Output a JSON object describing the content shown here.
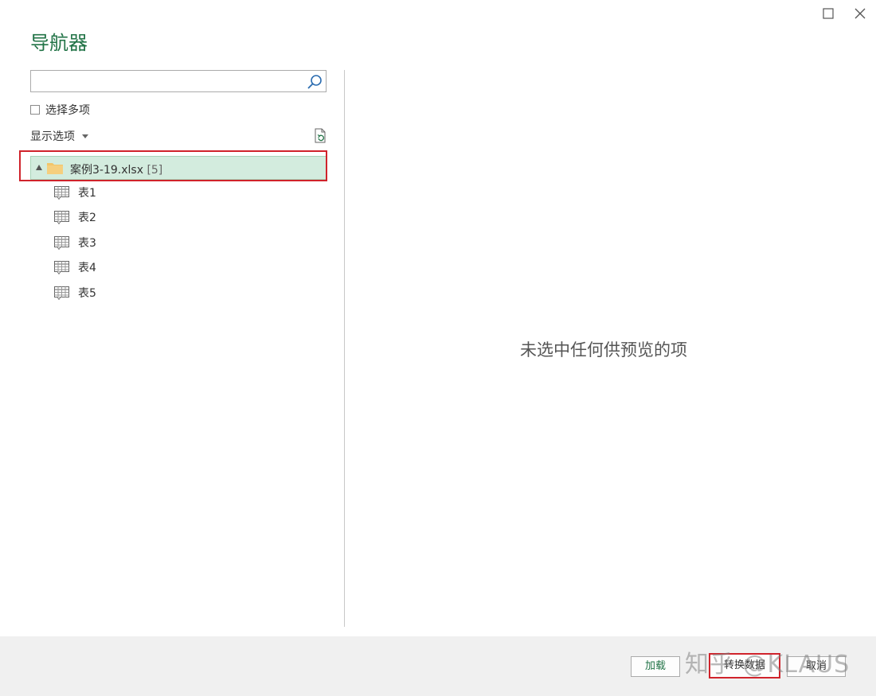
{
  "window": {
    "title": "导航器",
    "maximize_icon": "maximize-icon",
    "close_icon": "close-icon"
  },
  "search": {
    "value": "",
    "placeholder": "",
    "icon": "search-icon"
  },
  "multi_select": {
    "label": "选择多项",
    "checked": false
  },
  "display_options": {
    "label": "显示选项",
    "icon": "chevron-down-icon"
  },
  "refresh": {
    "icon": "refresh-icon"
  },
  "tree": {
    "root": {
      "name": "案例3-19.xlsx",
      "count": "[5]",
      "icon": "folder-icon",
      "expanded": true
    },
    "items": [
      {
        "label": "表1",
        "icon": "table-icon"
      },
      {
        "label": "表2",
        "icon": "table-icon"
      },
      {
        "label": "表3",
        "icon": "table-icon"
      },
      {
        "label": "表4",
        "icon": "table-icon"
      },
      {
        "label": "表5",
        "icon": "table-icon"
      }
    ]
  },
  "preview": {
    "empty_message": "未选中任何供预览的项"
  },
  "footer": {
    "load_label": "加载",
    "transform_label": "转换数据",
    "cancel_label": "取消",
    "watermark": "知乎 @KLAUS"
  },
  "colors": {
    "accent": "#217346",
    "selection_bg": "#d3ecde",
    "highlight_outline": "#d0232b",
    "folder": "#f2c56a",
    "footer_bg": "#f0f0f0"
  }
}
